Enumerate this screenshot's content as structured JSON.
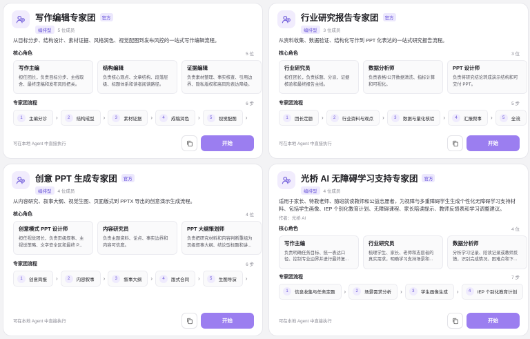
{
  "cards": [
    {
      "title": "写作编辑专家团",
      "official": "官方",
      "type": "编排型",
      "members": "5 位成员",
      "desc": "从目标分步、结构设计、素材证据、风格润色、视觉配图到发布风控的一站式写作编辑流程。",
      "author": "",
      "roles_label": "核心角色",
      "roles_count": "5 位",
      "roles": [
        {
          "name": "写作主编",
          "desc": "担任团长，负责目标分步、主线取舍、最终定稿和发布风险把关。"
        },
        {
          "name": "结构编辑",
          "desc": "负责核心观点、文章结构、段落层级、标题体系和读者阅读路径。"
        },
        {
          "name": "证据编辑",
          "desc": "负责素材整理、事实核查、引用边界、隐私版权和高风险表达降级。"
        }
      ],
      "flow_label": "专家团流程",
      "flow_count": "6 步",
      "steps": [
        "主编分诊",
        "结构成型",
        "素材证据",
        "成稿润色",
        "视觉配图"
      ],
      "foot_note": "可在本地 Agent 中直接执行",
      "start": "开始"
    },
    {
      "title": "行业研究报告专家团",
      "official": "官方",
      "type": "编排型",
      "members": "3 位成员",
      "desc": "从资料收集、数据验证、结构化写作到 PPT 化表达的一站式研究报告流程。",
      "author": "",
      "roles_label": "核心角色",
      "roles_count": "3 位",
      "roles": [
        {
          "name": "行业研究员",
          "desc": "担任团长，负责拆题、分派、证据核验和最终报告主线。"
        },
        {
          "name": "数据分析师",
          "desc": "负责表格/公开数据清洗、指标计算和可视化。"
        },
        {
          "name": "PPT 设计师",
          "desc": "负责将研究结论转成演示结构和可交付 PPT。"
        }
      ],
      "flow_label": "专家团流程",
      "flow_count": "5 步",
      "steps": [
        "团长定题",
        "行业资料与观点",
        "数据与量化核验",
        "汇报叙事",
        "全流"
      ],
      "foot_note": "可在本地 Agent 中直接执行",
      "start": "开始"
    },
    {
      "title": "创意 PPT 生成专家团",
      "official": "官方",
      "type": "编排型",
      "members": "4 位成员",
      "desc": "从内容研究、叙事大纲、视觉生图、页面版式到 PPTX 导出的创意演示生成流程。",
      "author": "",
      "roles_label": "核心角色",
      "roles_count": "4 位",
      "roles": [
        {
          "name": "创意模式 PPT 设计师",
          "desc": "担任视觉团长，负责页级叙事、主视觉策略、文字安全区和最终 P..."
        },
        {
          "name": "内容研究员",
          "desc": "负责主题资料、论点、事实边界和内容可信度。"
        },
        {
          "name": "PPT 大纲策划师",
          "desc": "负责把研究材料和内容判断重组为页级叙事大纲、结论型标题和讲..."
        }
      ],
      "flow_label": "专家团流程",
      "flow_count": "6 步",
      "steps": [
        "创意简报",
        "内容叙事",
        "叙事大纲",
        "版式合同",
        "生图导演"
      ],
      "foot_note": "可在本地 Agent 中直接执行",
      "start": "开始"
    },
    {
      "title": "光桥 AI 无障碍学习支持专家团",
      "official": "官方",
      "type": "编排型",
      "members": "4 位成员",
      "desc": "适用于家长、特教老师、随班就读教师和公益志愿者，为视障与多重障碍学生生成个性化无障碍学习支持材料、包括学生画像、IEP 个别化教育计划、无障碍课程、家长陪读提示、教师反馈表和学习调整建议。",
      "author": "作者：光桥 AI",
      "roles_label": "核心角色",
      "roles_count": "4 位",
      "roles": [
        {
          "name": "写作主编",
          "desc": "负责明确任务目标、统一表达口径、控制专业边界并进行最终复..."
        },
        {
          "name": "行业研究员",
          "desc": "梳理学生、家长、老师和志愿者的真实需求，明确学习支持场景和..."
        },
        {
          "name": "数据分析师",
          "desc": "分析学习记录、陪读记录或教师反馈，识别完成情况、困难点和下..."
        }
      ],
      "flow_label": "专家团流程",
      "flow_count": "7 步",
      "steps": [
        "信息收集与任务定题",
        "场景需求分析",
        "学生画像生成",
        "IEP 个别化教育计划"
      ],
      "foot_note": "可在本地 Agent 中直接执行",
      "start": "开始"
    }
  ]
}
